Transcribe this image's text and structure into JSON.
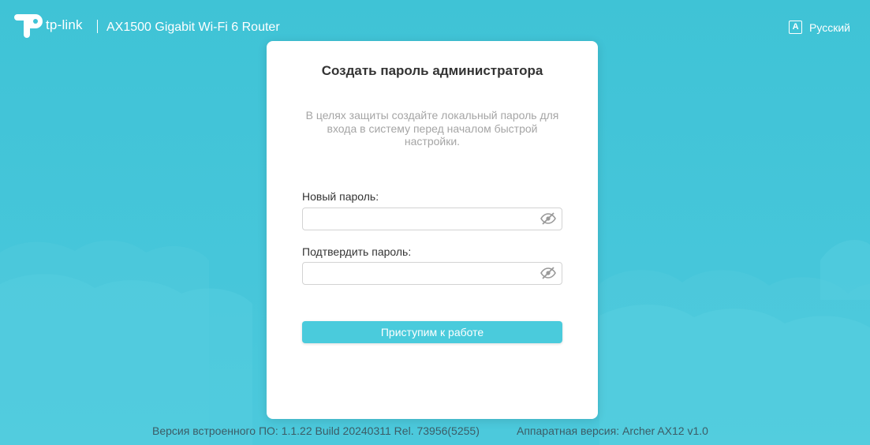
{
  "header": {
    "brand": "tp-link",
    "model": "AX1500 Gigabit Wi-Fi 6 Router",
    "language": {
      "icon": "A",
      "label": "Русский"
    }
  },
  "card": {
    "title": "Создать пароль администратора",
    "description": "В целях защиты создайте локальный пароль для входа в систему перед началом быстрой настройки.",
    "new_password": {
      "label": "Новый пароль:",
      "value": "",
      "placeholder": ""
    },
    "confirm_password": {
      "label": "Подтвердить пароль:",
      "value": "",
      "placeholder": ""
    },
    "submit_label": "Приступим к работе"
  },
  "footer": {
    "firmware": "Версия встроенного ПО: 1.1.22 Build 20240311 Rel. 73956(5255)",
    "hardware": "Аппаратная версия: Archer AX12 v1.0"
  },
  "colors": {
    "background": "#45c6d9",
    "accent": "#4acbdc",
    "card": "#ffffff"
  }
}
